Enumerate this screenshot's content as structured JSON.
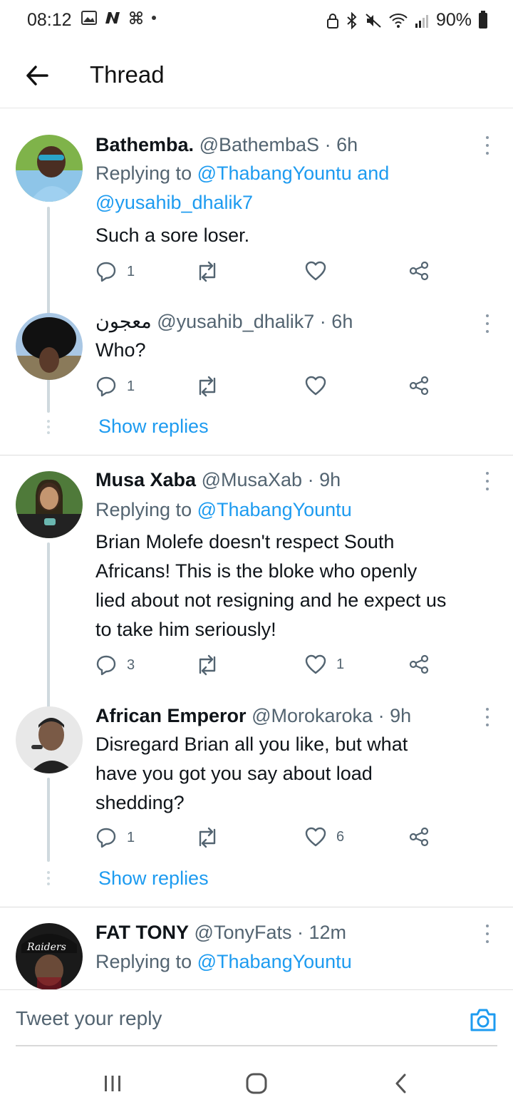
{
  "status_bar": {
    "time": "08:12",
    "battery": "90%",
    "left_icons": [
      "gallery-icon",
      "n-icon",
      "pinwheel-icon",
      "dot-icon"
    ],
    "right_icons": [
      "lock-icon",
      "bluetooth-icon",
      "mute-icon",
      "wifi-icon",
      "signal-icon",
      "battery-icon"
    ]
  },
  "header": {
    "title": "Thread",
    "back_icon": "arrow-left-icon"
  },
  "tweets": [
    {
      "name": "Bathemba.",
      "handle": "@BathembaS",
      "time": "6h",
      "replying_prefix": "Replying to",
      "replying_mentions": "@ThabangYountu and",
      "replying_mentions_2": "@yusahib_dhalik7",
      "text": "Such a sore loser.",
      "replies": "1",
      "retweets": "",
      "likes": ""
    },
    {
      "name": "معجون",
      "handle": "@yusahib_dhalik7",
      "time": "6h",
      "text": "Who?",
      "replies": "1",
      "retweets": "",
      "likes": ""
    },
    {
      "name": "Musa Xaba",
      "handle": "@MusaXab",
      "time": "9h",
      "replying_prefix": "Replying to",
      "replying_mentions": "@ThabangYountu",
      "text_lines": [
        "Brian Molefe doesn't respect South",
        "Africans! This is the bloke who openly",
        "lied about not resigning and he expect us",
        "to take him seriously!"
      ],
      "replies": "3",
      "retweets": "",
      "likes": "1"
    },
    {
      "name": "African Emperor",
      "handle": "@Morokaroka",
      "time": "9h",
      "text_lines": [
        "Disregard Brian all you like, but what",
        "have you got you say about load",
        "shedding?"
      ],
      "replies": "1",
      "retweets": "",
      "likes": "6"
    },
    {
      "name": "FAT TONY",
      "handle": "@TonyFats",
      "time": "12m",
      "replying_prefix": "Replying to",
      "replying_mentions": "@ThabangYountu"
    }
  ],
  "show_replies_label": "Show replies",
  "composer": {
    "placeholder": "Tweet your reply",
    "camera_icon": "camera-icon"
  },
  "nav": {
    "recents_icon": "recents-icon",
    "home_icon": "home-icon",
    "back_icon": "back-chevron-icon"
  },
  "colors": {
    "accent": "#1d9bf0",
    "secondary_text": "#536471",
    "primary_text": "#0f1419",
    "thread_line": "#cfd9de"
  }
}
